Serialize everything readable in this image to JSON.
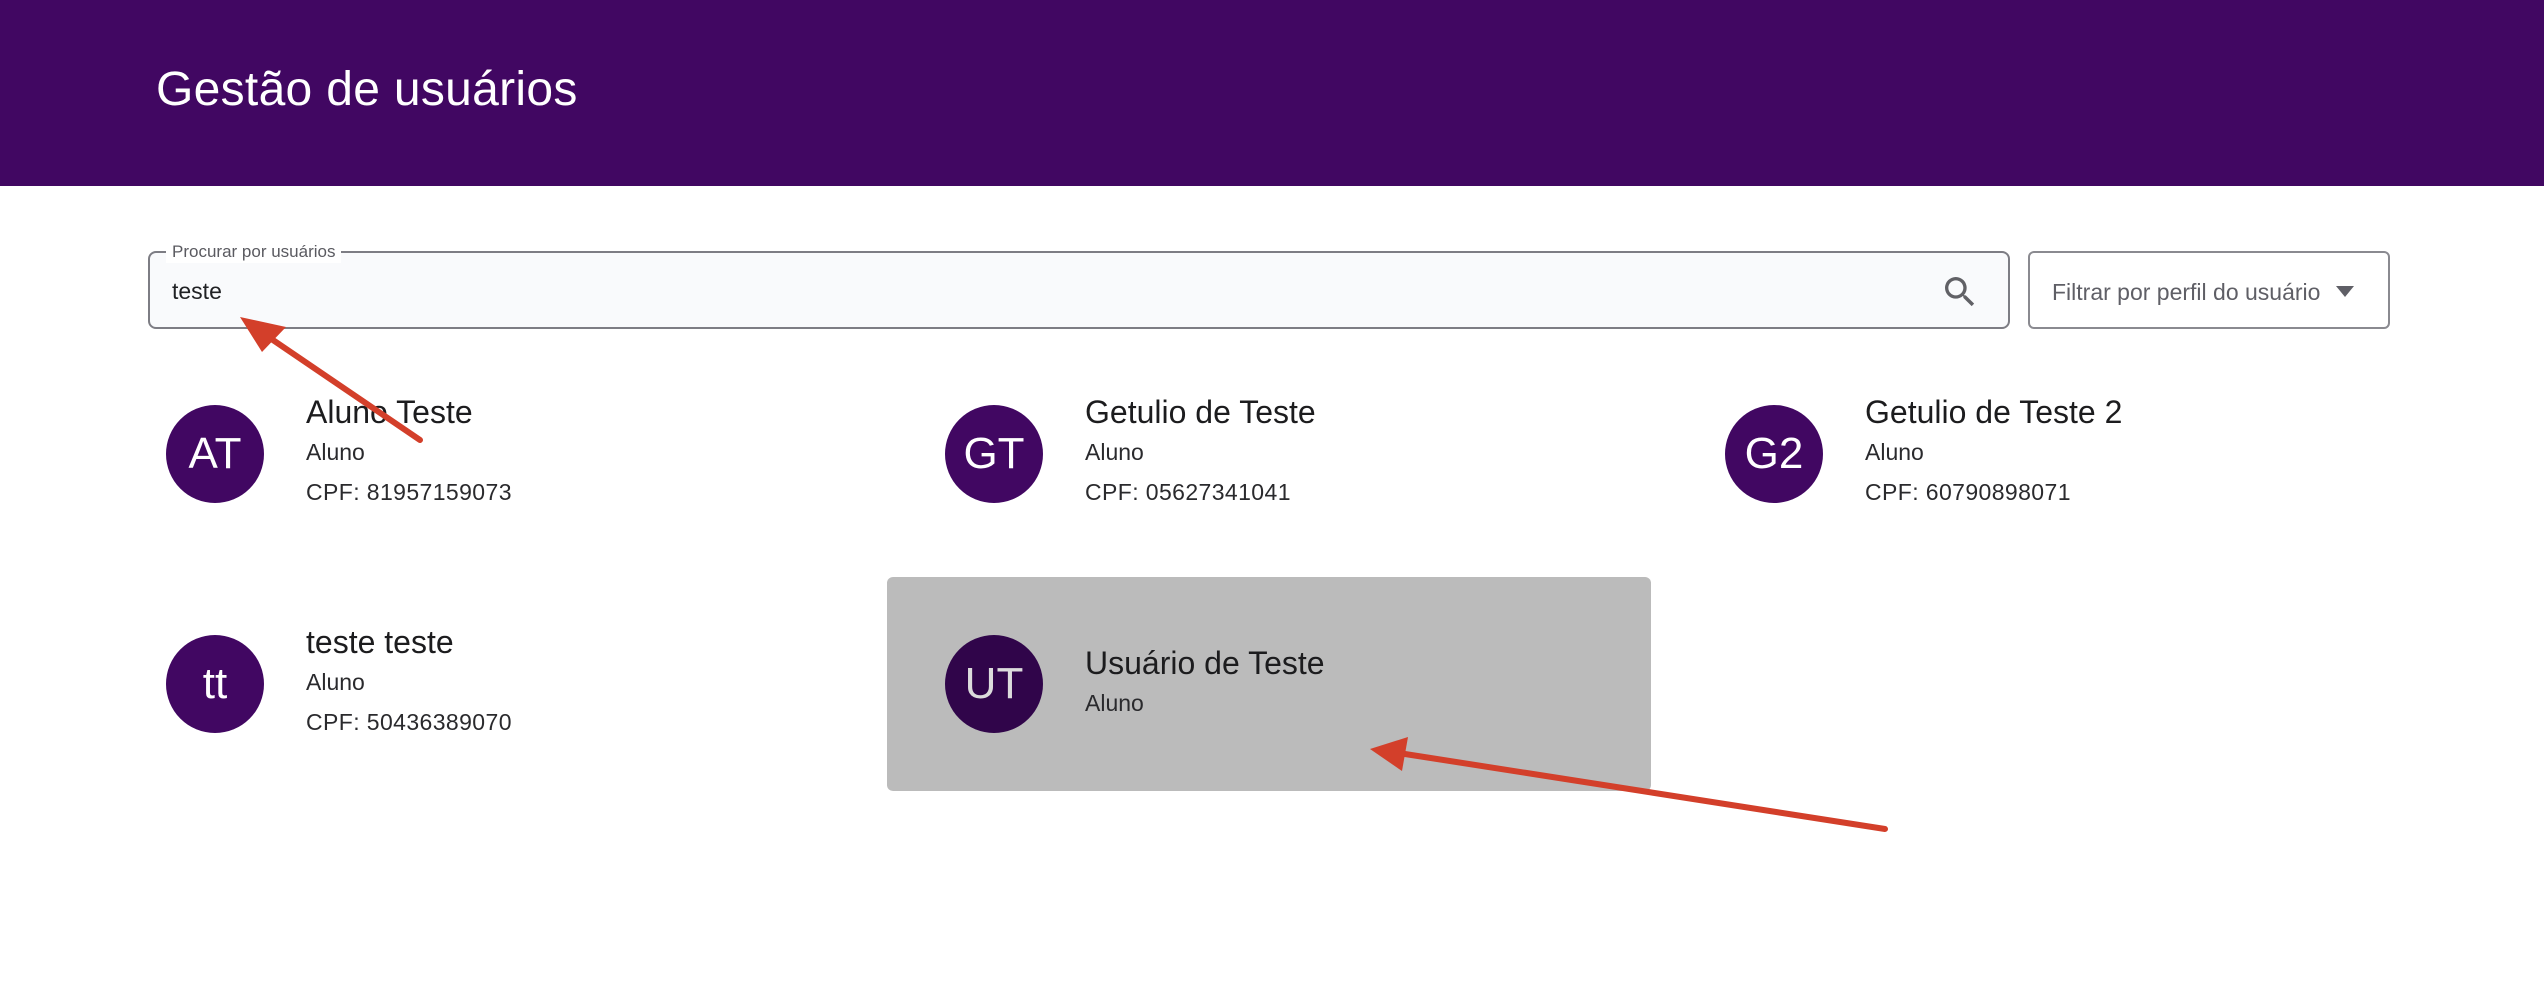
{
  "header": {
    "title": "Gestão de usuários"
  },
  "search": {
    "legend": "Procurar por usuários",
    "value": "teste"
  },
  "filter": {
    "label": "Filtrar por perfil do usuário"
  },
  "users": [
    {
      "initials": "AT",
      "name": "Aluno Teste",
      "role": "Aluno",
      "cpf": "CPF: 81957159073"
    },
    {
      "initials": "GT",
      "name": "Getulio de Teste",
      "role": "Aluno",
      "cpf": "CPF: 05627341041"
    },
    {
      "initials": "G2",
      "name": "Getulio de Teste 2",
      "role": "Aluno",
      "cpf": "CPF: 60790898071"
    },
    {
      "initials": "tt",
      "name": "teste teste",
      "role": "Aluno",
      "cpf": "CPF: 50436389070"
    },
    {
      "initials": "UT",
      "name": "Usuário de Teste",
      "role": "Aluno"
    }
  ],
  "colors": {
    "header_bg": "#410762",
    "avatar_bg": "#410762",
    "selected_card_bg": "#bbbbbb",
    "annotation_arrow": "#d33f2a"
  }
}
